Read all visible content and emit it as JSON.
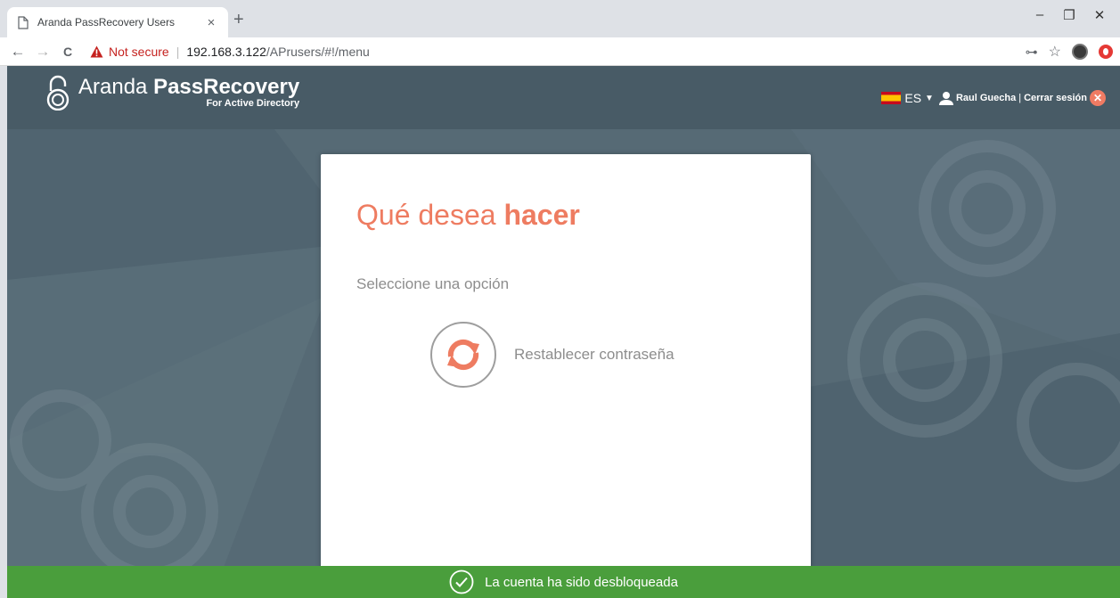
{
  "browser": {
    "tab_title": "Aranda PassRecovery Users",
    "tab_close": "×",
    "new_tab": "+",
    "window_controls": {
      "minimize": "–",
      "restore": "❐",
      "close": "✕"
    },
    "nav": {
      "back": "←",
      "forward": "→",
      "reload": "C"
    },
    "security_label": "Not secure",
    "url_host": "192.168.3.122",
    "url_path": "/APrusers/#!/menu",
    "icons": [
      "key-icon",
      "star-icon",
      "extension-avatar-icon",
      "opera-icon"
    ]
  },
  "header": {
    "logo_title_light": "Aranda ",
    "logo_title_bold": "PassRecovery",
    "logo_subtitle": "For Active Directory",
    "language": "ES",
    "caret": "▼",
    "user_name": "Raul Guecha",
    "separator": "|",
    "logout_label": "Cerrar sesión",
    "logout_icon": "✕"
  },
  "card": {
    "title_light": "Qué desea ",
    "title_bold": "hacer",
    "subtitle": "Seleccione una opción",
    "options": [
      {
        "label": "Restablecer contraseña",
        "icon": "refresh-icon"
      }
    ]
  },
  "toast": {
    "message": "La cuenta ha sido desbloqueada",
    "icon": "check-circle-icon"
  },
  "colors": {
    "accent": "#ee7c61",
    "header_bg": "#485b66",
    "page_bg": "#566a75",
    "success": "#4a9e3c",
    "warning_red": "#c5221f"
  }
}
